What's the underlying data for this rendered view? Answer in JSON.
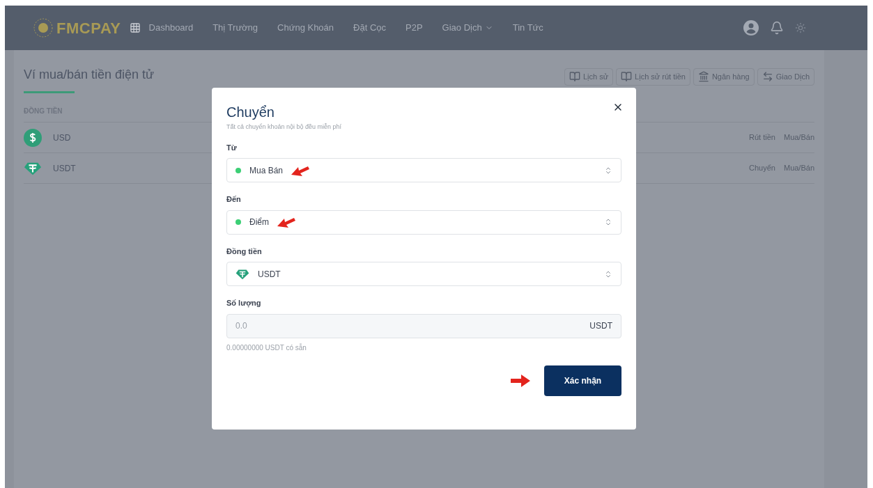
{
  "header": {
    "logo": "FMCPAY",
    "nav": [
      {
        "label": "Dashboard",
        "kind": "link"
      },
      {
        "label": "Thị Trường",
        "kind": "link"
      },
      {
        "label": "Chứng Khoán",
        "kind": "link"
      },
      {
        "label": "Đặt Cọc",
        "kind": "link"
      },
      {
        "label": "P2P",
        "kind": "link"
      },
      {
        "label": "Giao Dịch",
        "kind": "dropdown"
      },
      {
        "label": "Tin Tức",
        "kind": "link"
      }
    ]
  },
  "wallet": {
    "title": "Ví mua/bán tiền điện tử",
    "toolbar": [
      {
        "label": "Lịch sử",
        "kind": "book"
      },
      {
        "label": "Lịch sử rút tiền",
        "kind": "book"
      },
      {
        "label": "Ngân hàng",
        "kind": "bank"
      },
      {
        "label": "Giao Dịch",
        "kind": "swap"
      }
    ],
    "table": {
      "columns": [
        "ĐỒNG TIỀN"
      ],
      "rows": [
        {
          "coin": "USD",
          "kind": "usd",
          "actions": [
            "Rút tiền",
            "Mua/Bán"
          ]
        },
        {
          "coin": "USDT",
          "kind": "usdt",
          "actions": [
            "Chuyển",
            "Mua/Bán"
          ]
        }
      ]
    }
  },
  "modal": {
    "title": "Chuyển",
    "subtitle": "Tất cả chuyển khoản nội bộ đều miễn phí",
    "fields": [
      {
        "label": "Từ",
        "kind": "select",
        "value": "Mua Bán",
        "prefix": {
          "kind": "dot"
        },
        "annotated": true
      },
      {
        "label": "Đến",
        "kind": "select",
        "value": "Điểm",
        "prefix": {
          "kind": "dot"
        },
        "annotated": true
      },
      {
        "label": "Đồng tiền",
        "kind": "select",
        "value": "USDT",
        "prefix": {
          "kind": "usdt"
        },
        "annotated": false
      },
      {
        "label": "Số lượng",
        "kind": "amount",
        "placeholder": "0.0",
        "unit": "USDT",
        "hint": "0.00000000 USDT có sẵn"
      }
    ],
    "submit": {
      "label": "Xác nhận",
      "annotated": true
    }
  }
}
